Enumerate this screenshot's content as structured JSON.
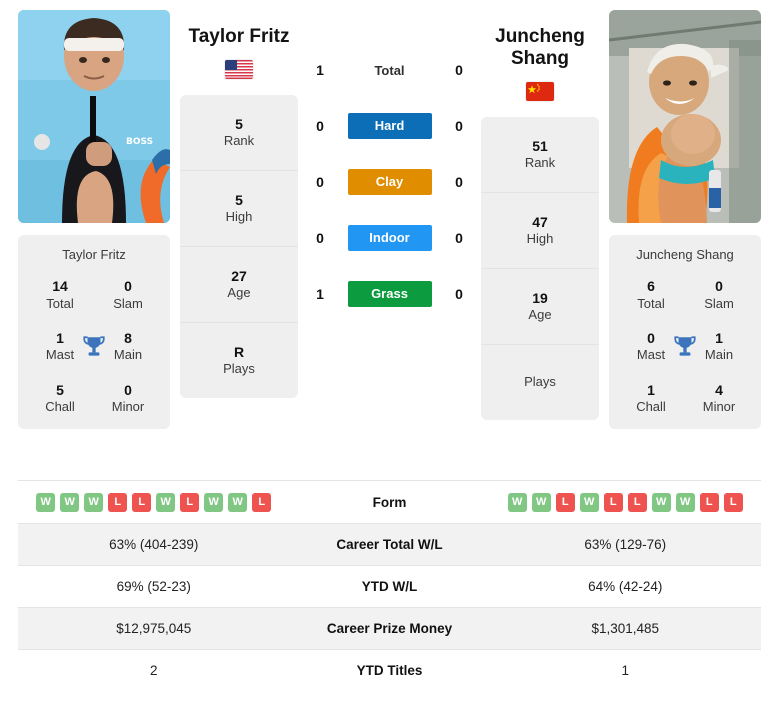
{
  "colors": {
    "hard": "#0d6eb8",
    "clay": "#e08e00",
    "indoor": "#2196f3",
    "grass": "#0d9b3f",
    "win": "#81c784",
    "loss": "#ef5350",
    "trophy": "#3b74bd",
    "card_bg": "#efefef",
    "row_shade": "#f2f2f2"
  },
  "players": {
    "left": {
      "name": "Taylor Fritz",
      "flag": "us-flag-icon",
      "photo_alt": "taylor-fritz-photo",
      "card_name": "Taylor Fritz",
      "titles": [
        {
          "value": "14",
          "label": "Total"
        },
        {
          "value": "0",
          "label": "Slam"
        },
        {
          "value": "1",
          "label": "Mast"
        },
        {
          "value": "8",
          "label": "Main"
        },
        {
          "value": "5",
          "label": "Chall"
        },
        {
          "value": "0",
          "label": "Minor"
        }
      ],
      "ranking": [
        {
          "value": "5",
          "label": "Rank"
        },
        {
          "value": "5",
          "label": "High"
        },
        {
          "value": "27",
          "label": "Age"
        },
        {
          "value": "R",
          "label": "Plays"
        }
      ],
      "form": [
        "W",
        "W",
        "W",
        "L",
        "L",
        "W",
        "L",
        "W",
        "W",
        "L"
      ],
      "career_wl": "63% (404-239)",
      "ytd_wl": "69% (52-23)",
      "prize_money": "$12,975,045",
      "ytd_titles": "2",
      "h2h": {
        "total": "1",
        "hard": "0",
        "clay": "0",
        "indoor": "0",
        "grass": "1"
      }
    },
    "right": {
      "name": "Juncheng Shang",
      "flag": "cn-flag-icon",
      "photo_alt": "juncheng-shang-photo",
      "card_name": "Juncheng Shang",
      "titles": [
        {
          "value": "6",
          "label": "Total"
        },
        {
          "value": "0",
          "label": "Slam"
        },
        {
          "value": "0",
          "label": "Mast"
        },
        {
          "value": "1",
          "label": "Main"
        },
        {
          "value": "1",
          "label": "Chall"
        },
        {
          "value": "4",
          "label": "Minor"
        }
      ],
      "ranking": [
        {
          "value": "51",
          "label": "Rank"
        },
        {
          "value": "47",
          "label": "High"
        },
        {
          "value": "19",
          "label": "Age"
        },
        {
          "value": "",
          "label": "Plays"
        }
      ],
      "form": [
        "W",
        "W",
        "L",
        "W",
        "L",
        "L",
        "W",
        "W",
        "L",
        "L"
      ],
      "career_wl": "63% (129-76)",
      "ytd_wl": "64% (42-24)",
      "prize_money": "$1,301,485",
      "ytd_titles": "1",
      "h2h": {
        "total": "0",
        "hard": "0",
        "clay": "0",
        "indoor": "0",
        "grass": "0"
      }
    }
  },
  "h2h_labels": {
    "total": "Total",
    "hard": "Hard",
    "clay": "Clay",
    "indoor": "Indoor",
    "grass": "Grass"
  },
  "stats_labels": {
    "form": "Form",
    "career_wl": "Career Total W/L",
    "ytd_wl": "YTD W/L",
    "prize_money": "Career Prize Money",
    "ytd_titles": "YTD Titles"
  }
}
